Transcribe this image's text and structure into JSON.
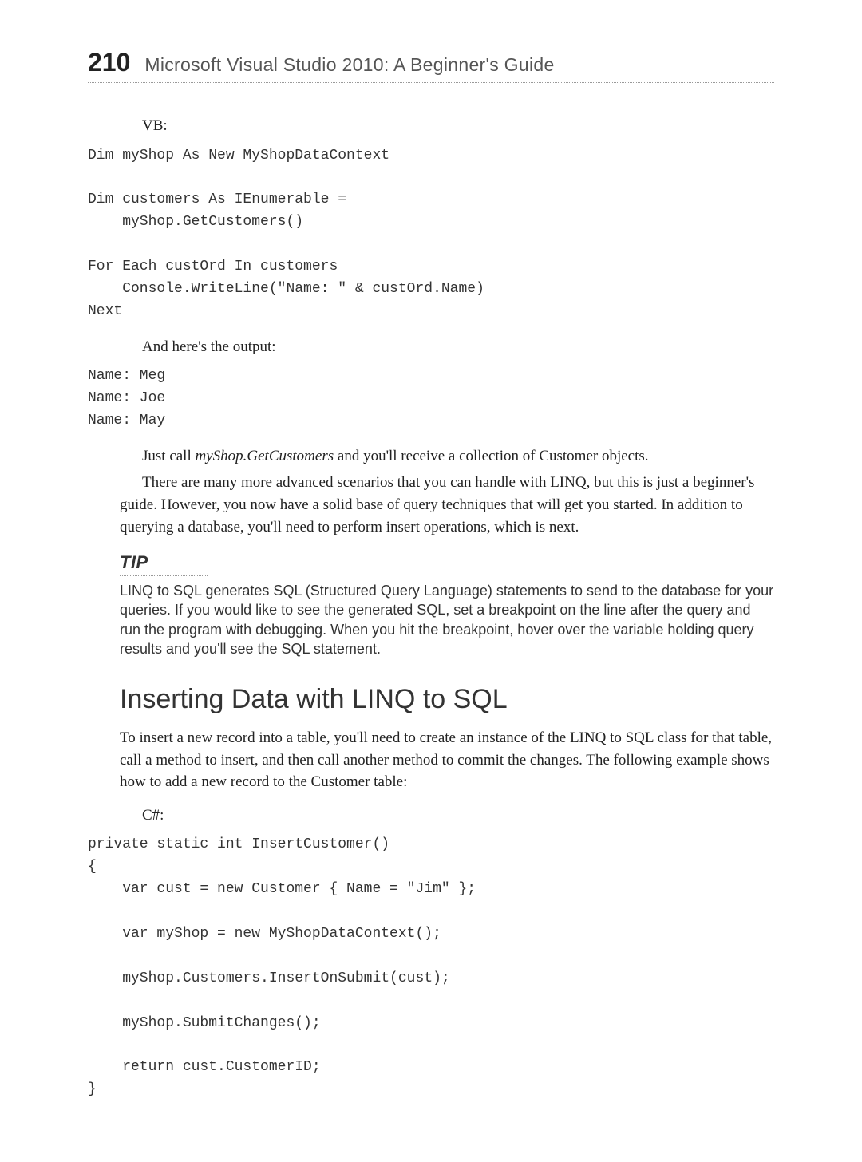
{
  "header": {
    "page_number": "210",
    "book_title": "Microsoft Visual Studio 2010: A Beginner's Guide"
  },
  "label_vb": "VB:",
  "code_vb": "Dim myShop As New MyShopDataContext\n\nDim customers As IEnumerable =\n    myShop.GetCustomers()\n\nFor Each custOrd In customers\n    Console.WriteLine(\"Name: \" & custOrd.Name)\nNext",
  "output_intro": "And here's the output:",
  "code_output": "Name: Meg\nName: Joe\nName: May",
  "para1_a": "Just call ",
  "para1_ital": "myShop.GetCustomers",
  "para1_b": " and you'll receive a collection of Customer objects.",
  "para2": "There are many more advanced scenarios that you can handle with LINQ, but this is just a beginner's guide. However, you now have a solid base of query techniques that will get you started. In addition to querying a database, you'll need to perform insert operations, which is next.",
  "tip": {
    "label": "TIP",
    "body": "LINQ to SQL generates SQL (Structured Query Language) statements to send to the database for your queries. If you would like to see the generated SQL, set a breakpoint on the line after the query and run the program with debugging. When you hit the breakpoint, hover over the variable holding query results and you'll see the SQL statement."
  },
  "section": {
    "heading": "Inserting Data with LINQ to SQL",
    "intro": "To insert a new record into a table, you'll need to create an instance of the LINQ to SQL class for that table, call a method to insert, and then call another method to commit the changes. The following example shows how to add a new record to the Customer table:"
  },
  "label_cs": "C#:",
  "code_cs": "private static int InsertCustomer()\n{\n    var cust = new Customer { Name = \"Jim\" };\n\n    var myShop = new MyShopDataContext();\n\n    myShop.Customers.InsertOnSubmit(cust);\n\n    myShop.SubmitChanges();\n\n    return cust.CustomerID;\n}"
}
